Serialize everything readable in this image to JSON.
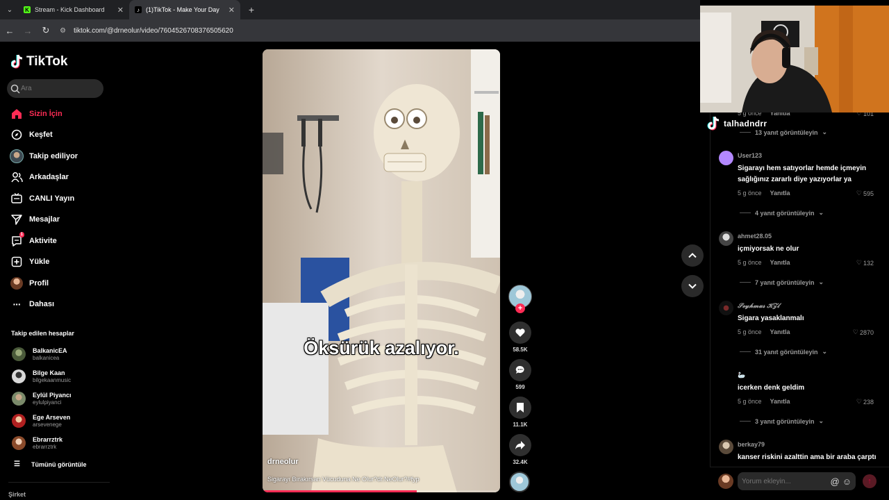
{
  "browser": {
    "tabs": [
      {
        "title": "Stream - Kick Dashboard",
        "favicon": "K"
      },
      {
        "title": "(1)TikTok - Make Your Day",
        "favicon": "tiktok-icon"
      }
    ],
    "url": "tiktok.com/@drneolur/video/7604526708376505620"
  },
  "sidebar": {
    "logo": "TikTok",
    "search_placeholder": "Ara",
    "nav": [
      {
        "label": "Sizin İçin",
        "icon": "home-icon"
      },
      {
        "label": "Keşfet",
        "icon": "compass-icon"
      },
      {
        "label": "Takip ediliyor",
        "icon": "following-avatar"
      },
      {
        "label": "Arkadaşlar",
        "icon": "friends-icon"
      },
      {
        "label": "CANLI Yayın",
        "icon": "live-icon"
      },
      {
        "label": "Mesajlar",
        "icon": "send-icon"
      },
      {
        "label": "Aktivite",
        "icon": "activity-icon",
        "badge": "1"
      },
      {
        "label": "Yükle",
        "icon": "upload-icon"
      },
      {
        "label": "Profil",
        "icon": "profile-avatar"
      },
      {
        "label": "Dahası",
        "icon": "more-icon"
      }
    ],
    "following_title": "Takip edilen hesaplar",
    "following": [
      {
        "name": "BalkanicEA",
        "handle": "balkanicea",
        "color": "#4a5a3a"
      },
      {
        "name": "Bilge Kaan",
        "handle": "bilgekaanmusic",
        "color": "#d8d8d8"
      },
      {
        "name": "Eylül Piyancı",
        "handle": "eylulpiyanci",
        "color": "#7a8a6a"
      },
      {
        "name": "Ege Arseven",
        "handle": "arsevenege",
        "color": "#b02020"
      },
      {
        "name": "Ebrarrztrk",
        "handle": "ebrarrztrk",
        "color": "#c8a080"
      }
    ],
    "see_all": "Tümünü görüntüle",
    "company": "Şirket"
  },
  "video": {
    "caption_overlay": "Öksürük azalıyor.",
    "author": "drneolur",
    "description": "Sigarayı Bırakırsan Vücuduna Ne Olur?dr.NeOlur?#fyp",
    "progress": 0.65,
    "likes": "58.5K",
    "comments": "599",
    "saves": "11.1K",
    "shares": "32.4K"
  },
  "stream_overlay": {
    "name": "talhadndrr"
  },
  "comments": {
    "partial_meta": {
      "time": "5 g önce",
      "reply": "Yanıtla",
      "likes": "101"
    },
    "partial_replies": "13 yanıt görüntüleyin",
    "items": [
      {
        "user": "User123",
        "text": "Sigarayı hem satıyorlar hemde içmeyin sağlığınız zararlı diye yazıyorlar ya",
        "time": "5 g önce",
        "reply": "Yanıtla",
        "likes": "595",
        "replies": "4 yanıt görüntüleyin",
        "color": "#b388ff"
      },
      {
        "user": "ahmet28.05",
        "text": "içmiyorsak ne olur",
        "time": "5 g önce",
        "reply": "Yanıtla",
        "likes": "132",
        "replies": "7 yanıt görüntüleyin",
        "color": "#888"
      },
      {
        "user": "𝓢𝓮𝔂𝓱𝓶𝓾𝓼 𝓚𝓩𝓵",
        "text": "Sigara yasaklanmalı",
        "time": "5 g önce",
        "reply": "Yanıtla",
        "likes": "2870",
        "replies": "31 yanıt görüntüleyin",
        "color": "#111"
      },
      {
        "user": "",
        "text": "icerken denk geldim",
        "time": "5 g önce",
        "reply": "Yanıtla",
        "likes": "238",
        "replies": "3 yanıt görüntüleyin",
        "color": "#000"
      },
      {
        "user": "berkay79",
        "text": "kanser riskini azalttin ama bir araba çarptı",
        "color": "#d9c7b0"
      }
    ],
    "input_placeholder": "Yorum ekleyin...",
    "mention_symbol": "@",
    "emoji_symbol": "☺"
  }
}
